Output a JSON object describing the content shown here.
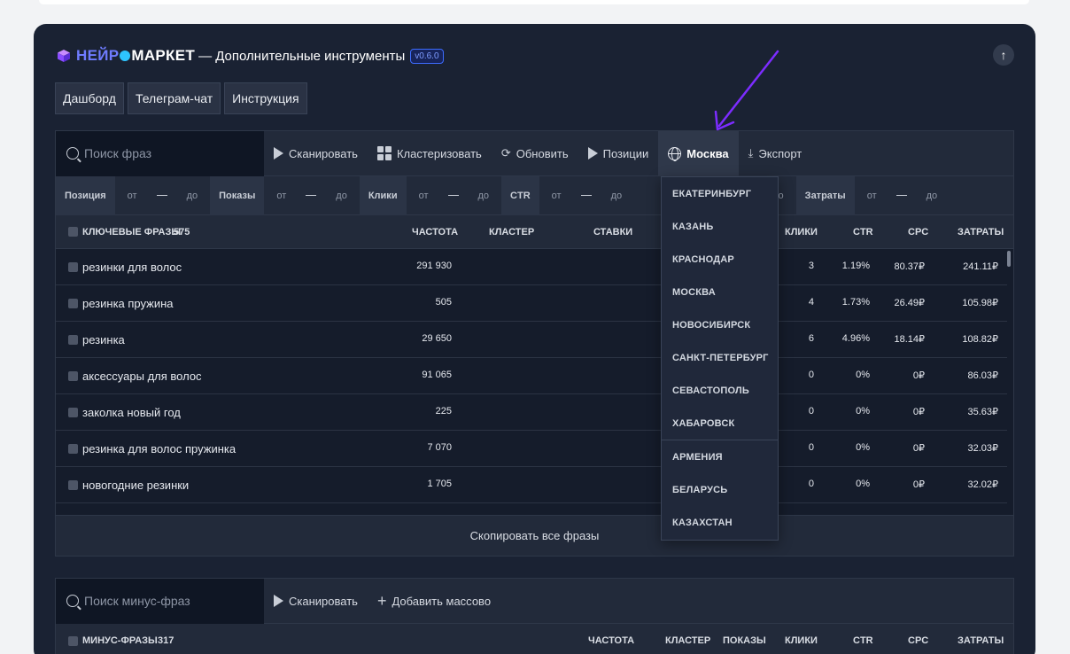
{
  "header": {
    "logo_part_a": "НЕЙР",
    "logo_part_b": "МАРКЕТ",
    "title": "— Дополнительные инструменты",
    "version": "v0.6.0"
  },
  "tabs": [
    "Дашборд",
    "Телеграм-чат",
    "Инструкция"
  ],
  "keywords_toolbar": {
    "search_placeholder": "Поиск фраз",
    "scan": "Сканировать",
    "cluster": "Кластеризовать",
    "refresh": "Обновить",
    "positions": "Позиции",
    "region": "Москва",
    "export": "Экспорт"
  },
  "filters": {
    "position": "Позиция",
    "shows": "Показы",
    "clicks": "Клики",
    "ctr": "CTR",
    "costs": "Затраты",
    "from": "от",
    "to": "до"
  },
  "keywords_table": {
    "header_label": "КЛЮЧЕВЫЕ ФРАЗЫ",
    "count": "575",
    "columns": {
      "freq": "ЧАСТОТА",
      "cluster": "КЛАСТЕР",
      "bids": "СТАВКИ",
      "clicks": "КЛИКИ",
      "ctr": "CTR",
      "cpc": "CPC",
      "costs": "ЗАТРАТЫ"
    },
    "rows": [
      {
        "phrase": "резинки для волос",
        "freq": "291 930",
        "clicks": "3",
        "ctr": "1.19%",
        "cpc": "80.37₽",
        "costs": "241.11₽"
      },
      {
        "phrase": "резинка пружина",
        "freq": "505",
        "clicks": "4",
        "ctr": "1.73%",
        "cpc": "26.49₽",
        "costs": "105.98₽"
      },
      {
        "phrase": "резинка",
        "freq": "29 650",
        "clicks": "6",
        "ctr": "4.96%",
        "cpc": "18.14₽",
        "costs": "108.82₽"
      },
      {
        "phrase": "аксессуары для волос",
        "freq": "91 065",
        "clicks": "0",
        "ctr": "0%",
        "cpc": "0₽",
        "costs": "86.03₽"
      },
      {
        "phrase": "заколка новый год",
        "freq": "225",
        "clicks": "0",
        "ctr": "0%",
        "cpc": "0₽",
        "costs": "35.63₽"
      },
      {
        "phrase": "резинка для волос пружинка",
        "freq": "7 070",
        "clicks": "0",
        "ctr": "0%",
        "cpc": "0₽",
        "costs": "32.03₽"
      },
      {
        "phrase": "новогодние резинки",
        "freq": "1 705",
        "clicks": "0",
        "ctr": "0%",
        "cpc": "0₽",
        "costs": "32.02₽"
      }
    ],
    "copy_all": "Скопировать все фразы"
  },
  "region_dropdown": {
    "cities": [
      "ЕКАТЕРИНБУРГ",
      "КАЗАНЬ",
      "КРАСНОДАР",
      "МОСКВА",
      "НОВОСИБИРСК",
      "САНКТ-ПЕТЕРБУРГ",
      "СЕВАСТОПОЛЬ",
      "ХАБАРОВСК"
    ],
    "countries": [
      "АРМЕНИЯ",
      "БЕЛАРУСЬ",
      "КАЗАХСТАН"
    ]
  },
  "minus_toolbar": {
    "search_placeholder": "Поиск минус-фраз",
    "scan": "Сканировать",
    "bulk_add": "Добавить массово"
  },
  "minus_table": {
    "header_label": "МИНУС-ФРАЗЫ",
    "count": "317",
    "columns": {
      "freq": "ЧАСТОТА",
      "cluster": "КЛАСТЕР",
      "shows": "ПОКАЗЫ",
      "clicks": "КЛИКИ",
      "ctr": "CTR",
      "cpc": "CPC",
      "costs": "ЗАТРАТЫ"
    }
  },
  "colors": {
    "panel": "#1a2233",
    "accent": "#7c2cff",
    "logo_blue": "#6f7cff"
  }
}
